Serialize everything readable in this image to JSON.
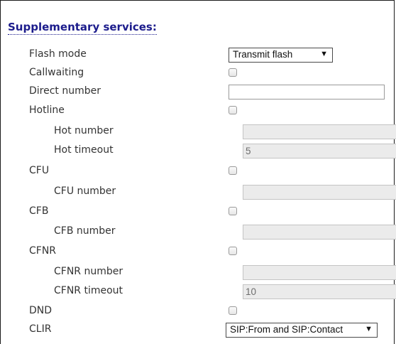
{
  "section": {
    "title": "Supplementary services:"
  },
  "fields": {
    "flash_mode": {
      "label": "Flash mode",
      "value": "Transmit flash"
    },
    "callwaiting": {
      "label": "Callwaiting",
      "checked": false
    },
    "direct_number": {
      "label": "Direct number",
      "value": ""
    },
    "hotline": {
      "label": "Hotline",
      "checked": false
    },
    "hot_number": {
      "label": "Hot number",
      "value": ""
    },
    "hot_timeout": {
      "label": "Hot timeout",
      "value": "5"
    },
    "cfu": {
      "label": "CFU",
      "checked": false
    },
    "cfu_number": {
      "label": "CFU number",
      "value": ""
    },
    "cfb": {
      "label": "CFB",
      "checked": false
    },
    "cfb_number": {
      "label": "CFB number",
      "value": ""
    },
    "cfnr": {
      "label": "CFNR",
      "checked": false
    },
    "cfnr_number": {
      "label": "CFNR number",
      "value": ""
    },
    "cfnr_timeout": {
      "label": "CFNR timeout",
      "value": "10"
    },
    "dnd": {
      "label": "DND",
      "checked": false
    },
    "clir": {
      "label": "CLIR",
      "value": "SIP:From and SIP:Contact"
    }
  },
  "icons": {
    "dropdown": "triangle-down-icon"
  },
  "colors": {
    "title": "#1c1c8c",
    "label": "#333333",
    "disabled_bg": "#ebebeb"
  }
}
